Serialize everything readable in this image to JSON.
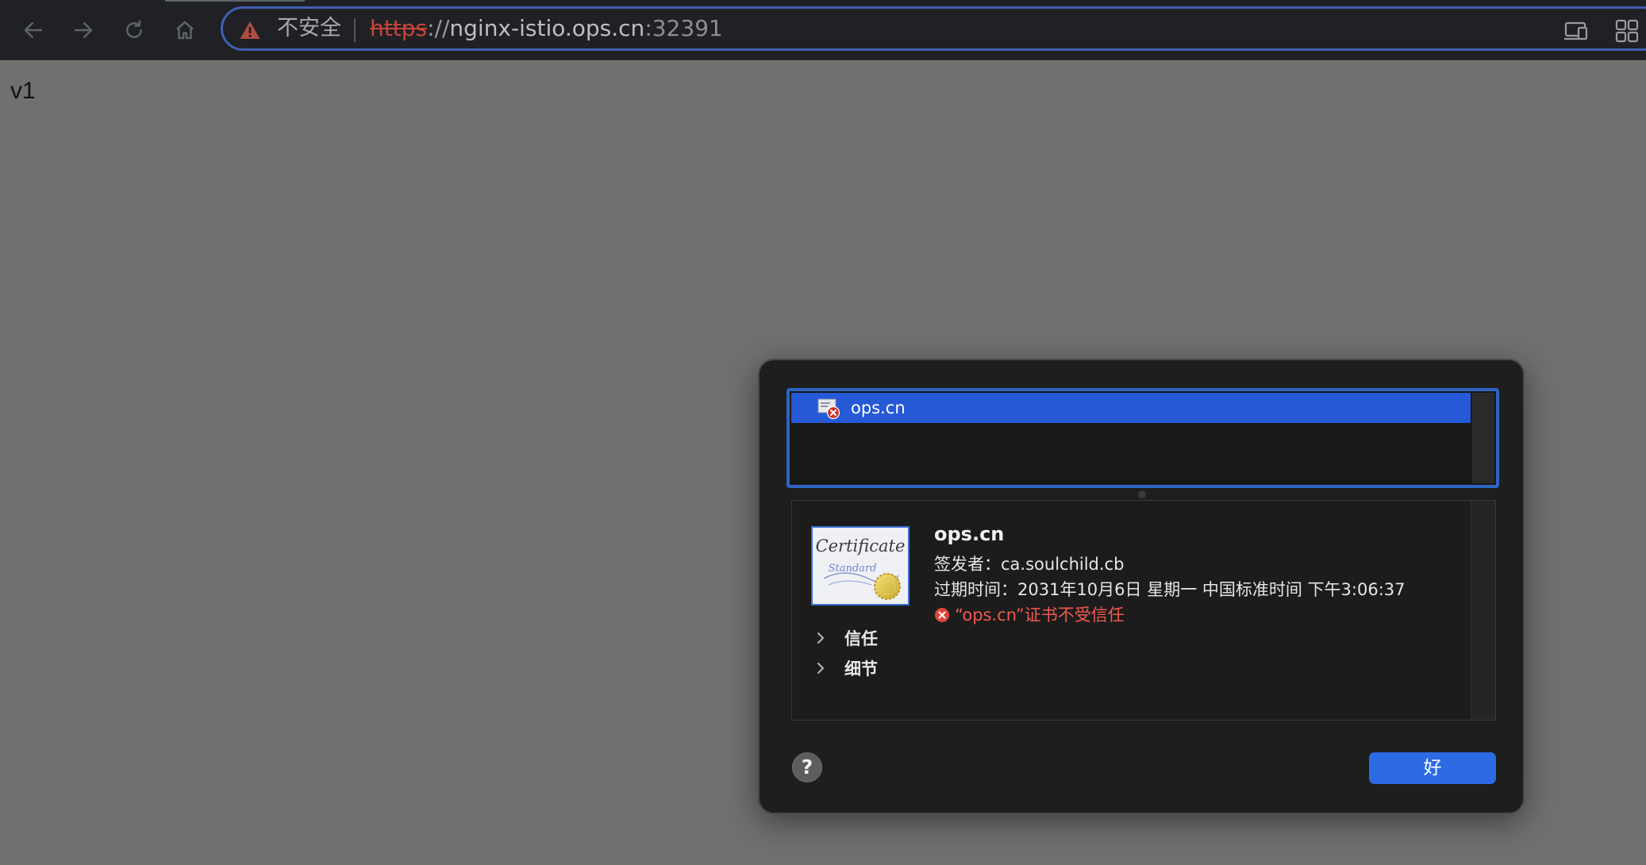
{
  "browser": {
    "security_label": "不安全",
    "url": {
      "scheme": "https",
      "separator": "://",
      "host": "nginx-istio.ops.cn",
      "port": ":32391"
    },
    "icons": [
      "back-icon",
      "forward-icon",
      "reload-icon",
      "home-icon",
      "warning-icon",
      "cast-icon",
      "extensions-icon"
    ]
  },
  "page": {
    "text": "v1"
  },
  "cert_dialog": {
    "list_items": [
      {
        "label": "ops.cn",
        "selected": true,
        "icon": "certificate-error-icon"
      }
    ],
    "detail": {
      "name": "ops.cn",
      "issuer": "签发者：ca.soulchild.cb",
      "expiry": "过期时间：2031年10月6日 星期一 中国标准时间 下午3:06:37",
      "error": "“ops.cn”证书不受信任",
      "badge_text": [
        "Certificate",
        "Standard"
      ],
      "sections": [
        "信任",
        "细节"
      ]
    },
    "help_label": "?",
    "ok_label": "好"
  },
  "colors": {
    "toolbar_bg": "#202124",
    "page_bg": "#6f716f",
    "accent": "#2d6be4",
    "error": "#f05a4f",
    "dialog_bg": "#1e1e1e"
  }
}
